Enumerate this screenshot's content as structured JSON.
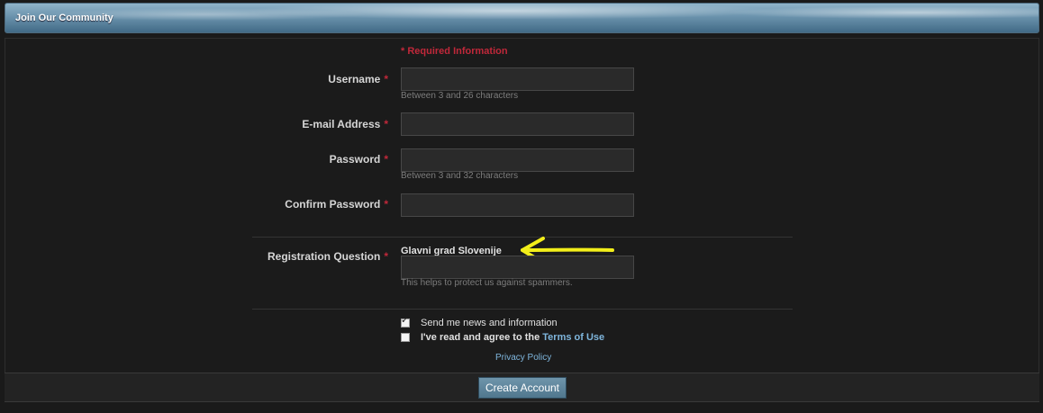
{
  "header": {
    "title": "Join Our Community"
  },
  "form": {
    "required_note": "* Required Information",
    "required_mark": "*",
    "username": {
      "label": "Username",
      "value": "",
      "hint": "Between 3 and 26 characters"
    },
    "email": {
      "label": "E-mail Address",
      "value": ""
    },
    "password": {
      "label": "Password",
      "value": "",
      "hint": "Between 3 and 32 characters"
    },
    "confirm_password": {
      "label": "Confirm Password",
      "value": ""
    },
    "registration_question": {
      "label": "Registration Question",
      "question": "Glavni grad Slovenije",
      "value": "",
      "hint": "This helps to protect us against spammers."
    },
    "news_checkbox": {
      "label": "Send me news and information",
      "checked": true
    },
    "terms_checkbox": {
      "label_prefix": "I've read and agree to the",
      "link_text": "Terms of Use",
      "checked": false
    },
    "privacy_link": "Privacy Policy",
    "submit_label": "Create Account"
  },
  "annotation": {
    "arrow_color": "#f2ee1a"
  },
  "colors": {
    "required": "#c0283a",
    "link": "#7fb6dd",
    "button": "#5f879e"
  }
}
